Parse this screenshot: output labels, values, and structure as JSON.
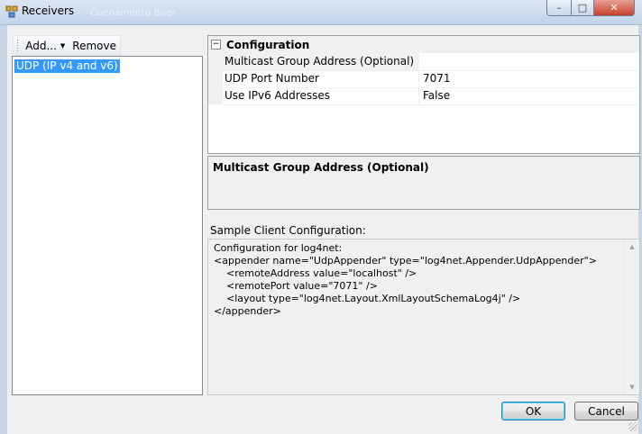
{
  "window": {
    "title": "Receivers",
    "ghost_text": "Cuenamento Boer",
    "buttons": {
      "minimize": "–",
      "maximize": "□",
      "close": "✕"
    }
  },
  "toolbar": {
    "add_label": "Add...",
    "remove_label": "Remove"
  },
  "receivers": {
    "items": [
      {
        "label": "UDP (IP v4 and v6)",
        "selected": true
      }
    ]
  },
  "property_grid": {
    "category": {
      "label": "Configuration",
      "expanded_symbol": "−"
    },
    "rows": [
      {
        "name": "Multicast Group Address (Optional)",
        "value": "",
        "selected": true
      },
      {
        "name": "UDP Port Number",
        "value": "7071",
        "selected": false
      },
      {
        "name": "Use IPv6 Addresses",
        "value": "False",
        "selected": false
      }
    ]
  },
  "description": {
    "title": "Multicast Group Address (Optional)"
  },
  "sample": {
    "label": "Sample Client Configuration:",
    "text": "Configuration for log4net:\n<appender name=\"UdpAppender\" type=\"log4net.Appender.UdpAppender\">\n    <remoteAddress value=\"localhost\" />\n    <remotePort value=\"7071\" />\n    <layout type=\"log4net.Layout.XmlLayoutSchemaLog4j\" />\n</appender>"
  },
  "dialog_buttons": {
    "ok_label": "OK",
    "cancel_label": "Cancel"
  },
  "icons": {
    "app": "receivers-app-icon",
    "dropdown": "chevron-down-icon",
    "scroll_up": "scroll-up-arrow-icon",
    "scroll_down": "scroll-down-arrow-icon"
  },
  "colors": {
    "selection": "#3399ff",
    "window_frame": "#c9d6e6"
  }
}
